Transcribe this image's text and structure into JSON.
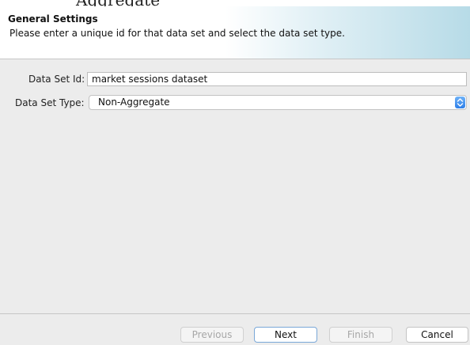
{
  "header": {
    "clipped_title": "Aggregate",
    "title": "General Settings",
    "description": "Please enter a unique id for that data set and select the data set type."
  },
  "form": {
    "id_label": "Data Set Id:",
    "id_value": "market sessions dataset",
    "type_label": "Data Set Type:",
    "type_value": "Non-Aggregate"
  },
  "buttons": {
    "previous": "Previous",
    "next": "Next",
    "finish": "Finish",
    "cancel": "Cancel"
  },
  "colors": {
    "header_gradient_end": "#b7dbe7",
    "stepper_blue": "#2e7fe8",
    "panel_background": "#ececec"
  }
}
